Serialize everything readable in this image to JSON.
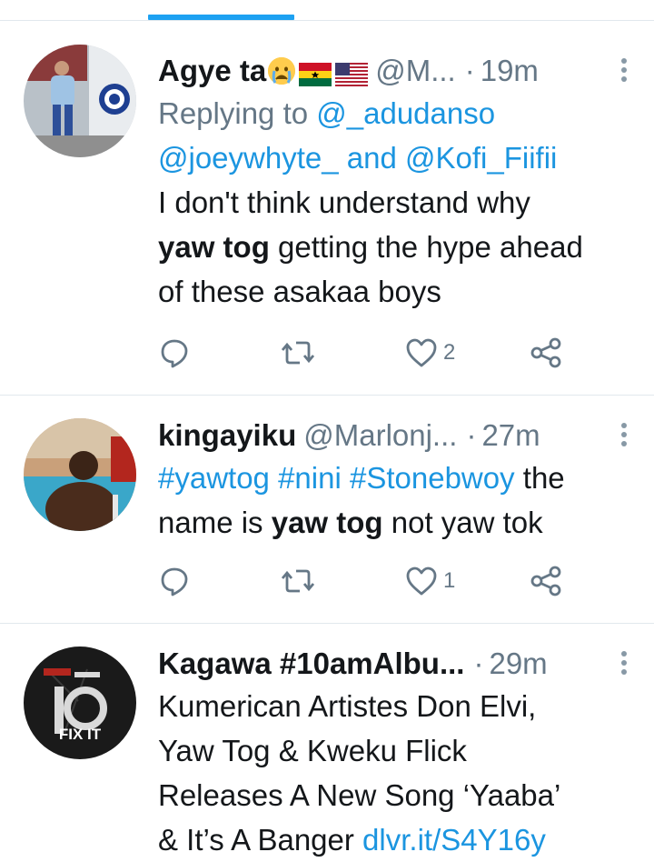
{
  "tweets": [
    {
      "name": "Agye ta",
      "handle": "@M...",
      "time": "19m",
      "reply_prefix": "Replying to ",
      "reply_handle_1": "@_adudanso",
      "reply_handle_2": "@joeywhyte_",
      "reply_and": " and ",
      "reply_handle_3": "@Kofi_Fiifii",
      "body_line1": "I don't think understand why",
      "body_bold": "yaw tog",
      "body_line2_rest": " getting the hype ahead",
      "body_line3": "of these asakaa boys",
      "like_count": "2",
      "avatar_icon": "profile-photo-chelsea"
    },
    {
      "name": "kingayiku",
      "handle": "@Marlonj...",
      "time": "27m",
      "hashtags": "#yawtog #nini #Stonebwoy",
      "body_after_tags": " the",
      "body_line2_pre": "name is ",
      "body_bold": "yaw tog",
      "body_line2_post": " not yaw tok",
      "like_count": "1",
      "avatar_icon": "profile-photo-pool"
    },
    {
      "name": "Kagawa #10amAlbu...",
      "time": "29m",
      "body_line1": "Kumerican Artistes Don Elvi,",
      "body_line2": "Yaw Tog & Kweku Flick",
      "body_line3": "Releases A New Song ‘Yaaba’",
      "body_line4": "& It’s A Banger ",
      "link": "dlvr.it/S4Y16y",
      "avatar_text": "FIX IT",
      "avatar_icon": "fix-it-logo"
    }
  ],
  "colors": {
    "accent": "#1b95e0",
    "muted": "#657786",
    "divider": "#e1e8ed"
  }
}
